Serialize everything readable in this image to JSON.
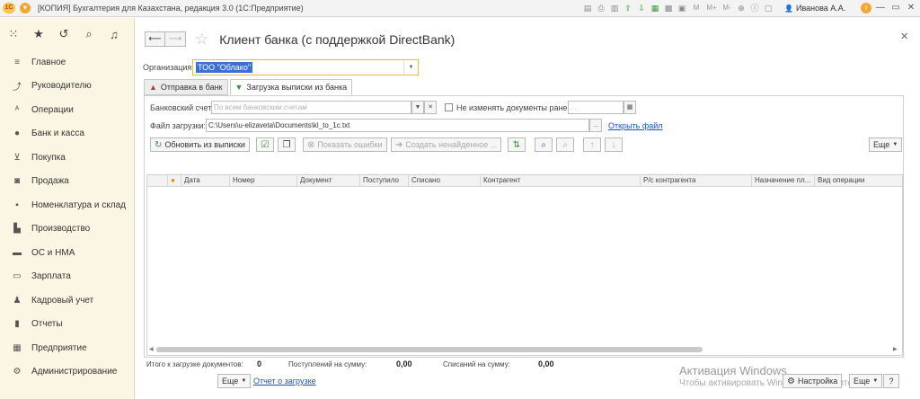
{
  "window": {
    "title": "[КОПИЯ] Бухгалтерия для Казахстана, редакция 3.0  (1С:Предприятие)",
    "user": "Иванова А.А.",
    "logo_text": "1С",
    "zoom_labels": [
      "M",
      "M+",
      "M-"
    ]
  },
  "sidebar": {
    "items": [
      {
        "label": "Главное",
        "icon": "menu-lines-icon"
      },
      {
        "label": "Руководителю",
        "icon": "trend-icon"
      },
      {
        "label": "Операции",
        "icon": "operations-icon"
      },
      {
        "label": "Банк и касса",
        "icon": "coin-icon"
      },
      {
        "label": "Покупка",
        "icon": "cart-icon"
      },
      {
        "label": "Продажа",
        "icon": "bag-icon"
      },
      {
        "label": "Номенклатура и склад",
        "icon": "boxes-icon"
      },
      {
        "label": "Производство",
        "icon": "factory-icon"
      },
      {
        "label": "ОС и НМА",
        "icon": "truck-icon"
      },
      {
        "label": "Зарплата",
        "icon": "wallet-icon"
      },
      {
        "label": "Кадровый учет",
        "icon": "people-icon"
      },
      {
        "label": "Отчеты",
        "icon": "bar-chart-icon"
      },
      {
        "label": "Предприятие",
        "icon": "building-icon"
      },
      {
        "label": "Администрирование",
        "icon": "gear-icon"
      }
    ]
  },
  "page": {
    "title": "Клиент банка (с поддержкой DirectBank)"
  },
  "organization": {
    "label": "Организация:",
    "value": "ТОО \"Облако\""
  },
  "tabs": [
    {
      "label": "Отправка в банк",
      "active": false
    },
    {
      "label": "Загрузка выписки из банка",
      "active": true
    }
  ],
  "form": {
    "bank_account_label": "Банковский счет:",
    "bank_account_placeholder": "По всем банковским счетам",
    "no_change_docs_label": "Не изменять документы ранее:",
    "date_placeholder": ". .",
    "file_label": "Файл загрузки:",
    "file_path": "C:\\Users\\u-elizaveta\\Documents\\kl_to_1c.txt",
    "open_file_link": "Открыть файл",
    "browse_label": "..."
  },
  "toolbar": {
    "refresh_label": "Обновить из выписки",
    "show_errors_label": "Показать ошибки",
    "create_unfound_label": "Создать ненайденное ...",
    "more_label": "Еще"
  },
  "table": {
    "columns": [
      "Дата",
      "Номер",
      "Документ",
      "Поступило",
      "Списано",
      "Контрагент",
      "Р/с контрагента",
      "Назначение пл...",
      "Вид операции"
    ],
    "rows": []
  },
  "footer": {
    "to_load_label": "Итого к загрузке документов:",
    "to_load_value": "0",
    "receipts_label": "Поступлений на сумму:",
    "receipts_value": "0,00",
    "writeoffs_label": "Списаний на сумму:",
    "writeoffs_value": "0,00",
    "more_label": "Еще",
    "report_link": "Отчет о загрузке",
    "settings_label": "Настройка",
    "more2_label": "Еще",
    "help_label": "?"
  },
  "watermark": {
    "line1": "Активация Windows",
    "line2": "Чтобы активировать Windows, перейдите в"
  }
}
